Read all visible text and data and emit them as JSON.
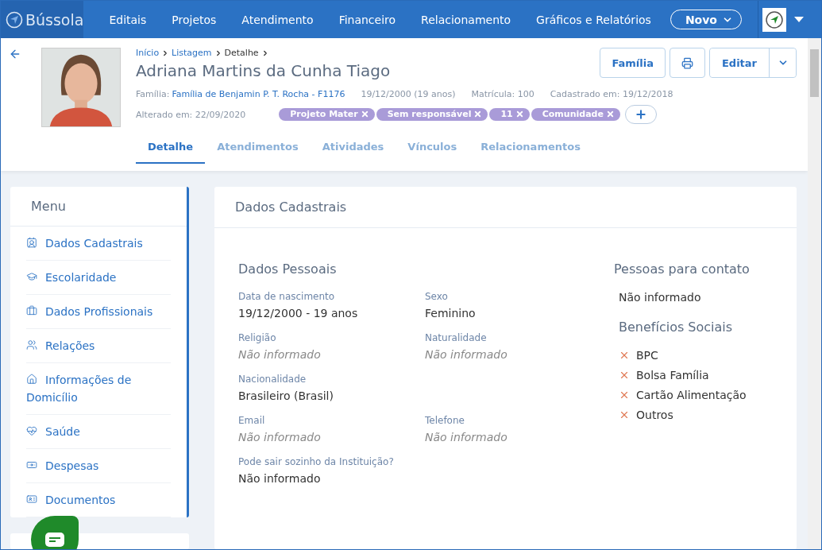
{
  "brand": "Bússola",
  "nav": [
    {
      "label": "Editais"
    },
    {
      "label": "Projetos"
    },
    {
      "label": "Atendimento"
    },
    {
      "label": "Financeiro"
    },
    {
      "label": "Relacionamento"
    },
    {
      "label": "Gráficos e Relatórios"
    }
  ],
  "new_button": "Novo",
  "breadcrumb": [
    {
      "label": "Início",
      "link": true
    },
    {
      "label": "Listagem",
      "link": true
    },
    {
      "label": "Detalhe",
      "link": false
    }
  ],
  "person": {
    "name": "Adriana Martins da Cunha Tiago",
    "family_label": "Família:",
    "family": "Família de Benjamin P. T. Rocha - F1176",
    "birth": "19/12/2000 (19 anos)",
    "registration": "Matrícula: 100",
    "created": "Cadastrado em: 19/12/2018",
    "changed": "Alterado em: 22/09/2020"
  },
  "tags": [
    {
      "label": "Projeto Mater"
    },
    {
      "label": "Sem responsável"
    },
    {
      "label": "11"
    },
    {
      "label": "Comunidade"
    }
  ],
  "actions": {
    "family": "Família",
    "edit": "Editar"
  },
  "tabs": [
    {
      "label": "Detalhe",
      "selected": true
    },
    {
      "label": "Atendimentos",
      "selected": false
    },
    {
      "label": "Atividades",
      "selected": false
    },
    {
      "label": "Vínculos",
      "selected": false
    },
    {
      "label": "Relacionamentos",
      "selected": false
    }
  ],
  "menu": {
    "title": "Menu",
    "items": [
      {
        "label": "Dados Cadastrais"
      },
      {
        "label": "Escolaridade"
      },
      {
        "label": "Dados Profissionais"
      },
      {
        "label": "Relações"
      },
      {
        "label": "Informações de Domicílio"
      },
      {
        "label": "Saúde"
      },
      {
        "label": "Despesas"
      },
      {
        "label": "Documentos"
      }
    ]
  },
  "panel": {
    "title": "Dados Cadastrais",
    "section": "Dados Pessoais",
    "fields": [
      {
        "label": "Data de nascimento",
        "value": "19/12/2000 - 19 anos",
        "empty": false
      },
      {
        "label": "Sexo",
        "value": "Feminino",
        "empty": false
      },
      {
        "label": "Religião",
        "value": "Não informado",
        "empty": true
      },
      {
        "label": "Naturalidade",
        "value": "Não informado",
        "empty": true
      },
      {
        "label": "Nacionalidade",
        "value": "Brasileiro (Brasil)",
        "empty": false,
        "wide": true
      },
      {
        "label": "Email",
        "value": "Não informado",
        "empty": true
      },
      {
        "label": "Telefone",
        "value": "Não informado",
        "empty": true
      },
      {
        "label": "Pode sair sozinho da Instituição?",
        "value": "Não informado",
        "empty": false,
        "wide": true
      }
    ],
    "contacts_title": "Pessoas para contato",
    "contacts_value": "Não informado",
    "benefits_title": "Benefícios Sociais",
    "benefits": [
      {
        "label": "BPC",
        "checked": false
      },
      {
        "label": "Bolsa Família",
        "checked": false
      },
      {
        "label": "Cartão Alimentação",
        "checked": false
      },
      {
        "label": "Outros",
        "checked": false
      }
    ]
  }
}
